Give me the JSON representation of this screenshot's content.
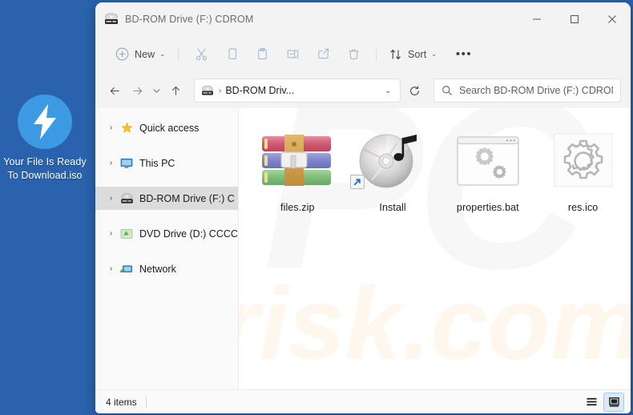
{
  "desktop": {
    "background_color": "#2a62ad",
    "icon": {
      "name": "lightning-bolt-icon",
      "label": "Your File Is Ready To Download.iso",
      "circle_color": "#3b9ae1",
      "bolt_color": "#ffffff"
    }
  },
  "window": {
    "title": "BD-ROM Drive (F:) CDROM",
    "title_icon": "cd-drive-icon",
    "controls": {
      "minimize": "–",
      "maximize": "□",
      "close": "✕"
    }
  },
  "toolbar": {
    "new_label": "New",
    "new_chevron": "⌄",
    "sort_label": "Sort",
    "sort_chevron": "⌄",
    "more_label": "•••",
    "items": [
      {
        "name": "cut-icon",
        "tooltip": "Cut"
      },
      {
        "name": "copy-icon",
        "tooltip": "Copy"
      },
      {
        "name": "paste-icon",
        "tooltip": "Paste"
      },
      {
        "name": "rename-icon",
        "tooltip": "Rename"
      },
      {
        "name": "share-icon",
        "tooltip": "Share"
      },
      {
        "name": "delete-icon",
        "tooltip": "Delete"
      }
    ]
  },
  "addressbar": {
    "back_icon": "arrow-left-icon",
    "forward_icon": "arrow-right-icon",
    "recent_icon": "chevron-down-icon",
    "up_icon": "arrow-up-icon",
    "crumb_icon": "cd-drive-icon",
    "separator": "›",
    "path": "BD-ROM Driv...",
    "dropdown_chevron": "⌄",
    "refresh_icon": "refresh-icon"
  },
  "search": {
    "icon": "search-icon",
    "placeholder": "Search BD-ROM Drive (F:) CDROM",
    "value": ""
  },
  "sidebar": {
    "items": [
      {
        "label": "Quick access",
        "icon": "star-icon",
        "twisty": "›",
        "selected": false
      },
      {
        "label": "This PC",
        "icon": "monitor-icon",
        "twisty": "›",
        "selected": false
      },
      {
        "label": "BD-ROM Drive (F:) C",
        "icon": "cd-drive-icon",
        "twisty": "›",
        "selected": true
      },
      {
        "label": "DVD Drive (D:) CCCC",
        "icon": "dvd-drive-icon",
        "twisty": "›",
        "selected": false
      },
      {
        "label": "Network",
        "icon": "network-icon",
        "twisty": "›",
        "selected": false
      }
    ]
  },
  "files": [
    {
      "name": "files.zip",
      "icon": "winrar-archive-icon",
      "shortcut": false
    },
    {
      "name": "Install",
      "icon": "cd-media-music-icon",
      "shortcut": true
    },
    {
      "name": "properties.bat",
      "icon": "bat-script-gears-icon",
      "shortcut": false
    },
    {
      "name": "res.ico",
      "icon": "gear-outline-icon",
      "shortcut": false
    }
  ],
  "statusbar": {
    "item_count": "4 items",
    "details_view_icon": "details-view-icon",
    "large_icons_view_icon": "large-icons-view-icon"
  },
  "watermarks": {
    "primary": "PC",
    "secondary": "risk.com"
  }
}
